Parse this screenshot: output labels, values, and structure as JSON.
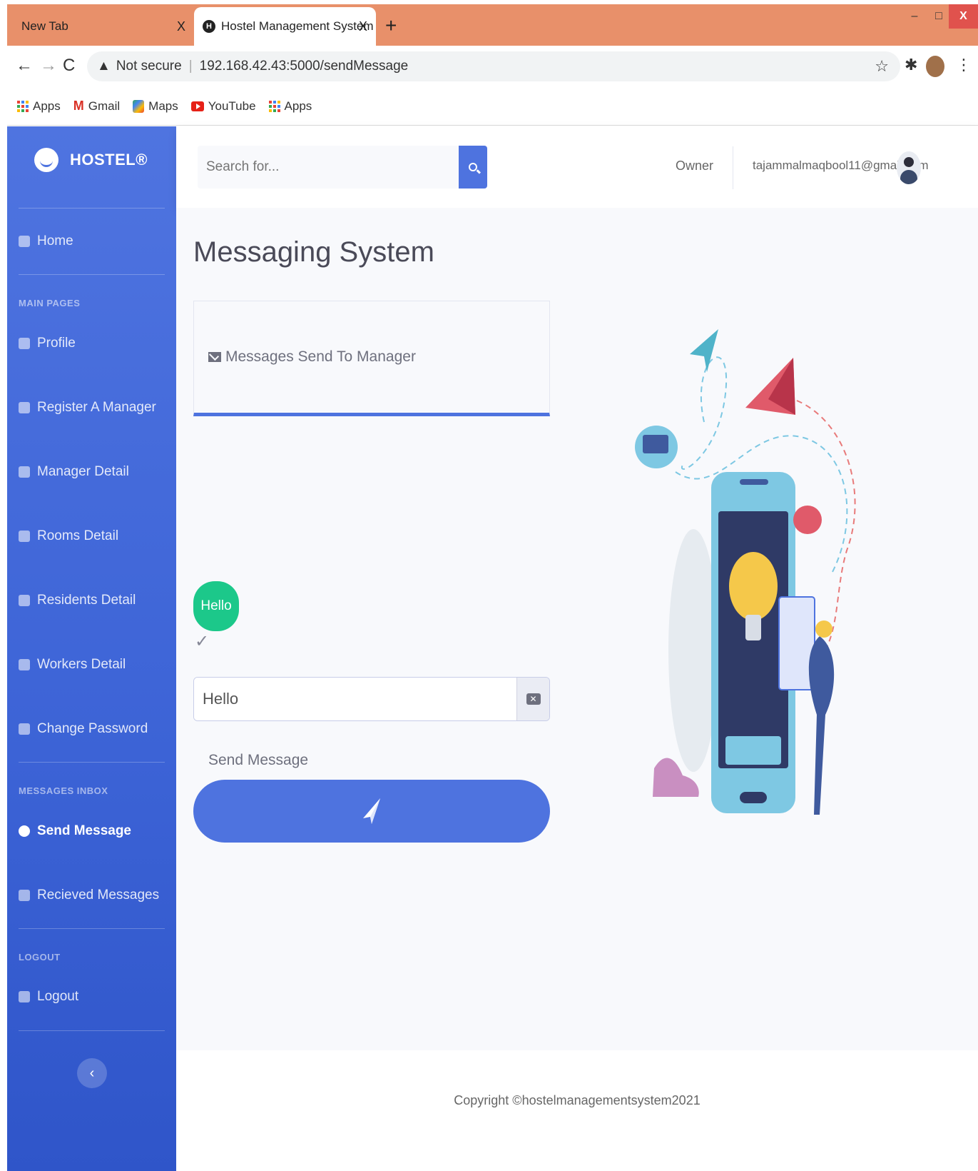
{
  "browser": {
    "tabs": [
      {
        "title": "New Tab",
        "close": "X"
      },
      {
        "title": "Hostel Management System",
        "close": "X"
      }
    ],
    "new_tab": "+",
    "window_controls": {
      "minimize": "–",
      "maximize": "□",
      "close": "X"
    },
    "address": {
      "security": "Not secure",
      "url": "192.168.42.43:5000/sendMessage"
    },
    "bookmarks": [
      "Apps",
      "Gmail",
      "Maps",
      "YouTube",
      "Apps"
    ]
  },
  "sidebar": {
    "brand": "HOSTEL®",
    "home": "Home",
    "heading_main": "MAIN PAGES",
    "main_items": [
      "Profile",
      "Register A Manager",
      "Manager Detail",
      "Rooms Detail",
      "Residents Detail",
      "Workers Detail",
      "Change Password"
    ],
    "heading_messages": "MESSAGES INBOX",
    "message_items": [
      "Send Message",
      "Recieved Messages"
    ],
    "heading_logout": "LOGOUT",
    "logout": "Logout",
    "toggle": "‹"
  },
  "topbar": {
    "search_placeholder": "Search for...",
    "role": "Owner",
    "email": "tajammalmaqbool11@gmail.com"
  },
  "main": {
    "title": "Messaging System",
    "card_title": "Messages Send To Manager",
    "messages": [
      {
        "text": "Hello"
      }
    ],
    "input_value": "Hello",
    "send_label": "Send Message"
  },
  "footer": {
    "copyright": "Copyright ©hostelmanagementsystem2021"
  },
  "colors": {
    "primary": "#4e73df",
    "success": "#1cc88a",
    "tab_strip": "#e8906a"
  }
}
